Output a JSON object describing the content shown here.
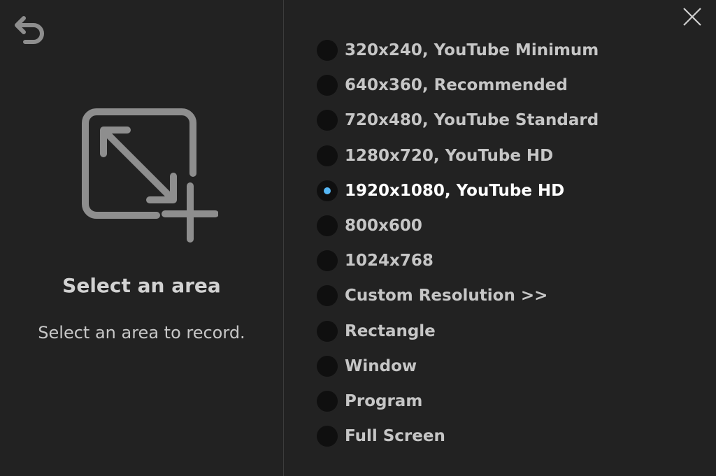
{
  "left_panel": {
    "title": "Select an area",
    "description": "Select an area to record.",
    "back_icon": "undo-arrow-icon",
    "area_icon": "resize-area-add-icon"
  },
  "close_icon": "close-x-icon",
  "options": [
    {
      "label": "320x240, YouTube Minimum",
      "selected": false
    },
    {
      "label": "640x360, Recommended",
      "selected": false
    },
    {
      "label": "720x480, YouTube Standard",
      "selected": false
    },
    {
      "label": "1280x720, YouTube HD",
      "selected": false
    },
    {
      "label": "1920x1080, YouTube HD",
      "selected": true
    },
    {
      "label": "800x600",
      "selected": false
    },
    {
      "label": "1024x768",
      "selected": false
    },
    {
      "label": "Custom Resolution >>",
      "selected": false
    },
    {
      "label": "Rectangle",
      "selected": false
    },
    {
      "label": "Window",
      "selected": false
    },
    {
      "label": "Program",
      "selected": false
    },
    {
      "label": "Full Screen",
      "selected": false
    }
  ],
  "colors": {
    "background": "#222222",
    "accent": "#56b7f5",
    "icon": "#8e8e8e"
  }
}
